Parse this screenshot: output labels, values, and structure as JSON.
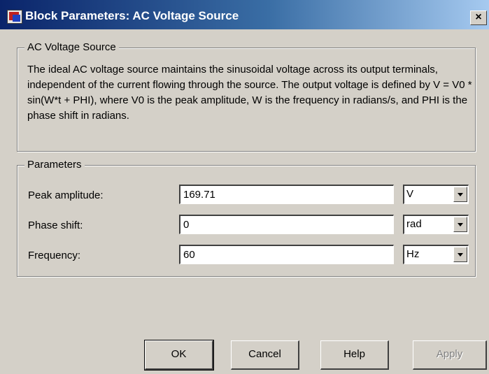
{
  "window": {
    "title": "Block Parameters: AC Voltage Source",
    "close_glyph": "×"
  },
  "description_group": {
    "legend": "AC Voltage Source",
    "text": "The ideal AC voltage source maintains the sinusoidal voltage across its output terminals, independent of the current flowing through the source. The output voltage is defined by  V = V0 * sin(W*t + PHI), where V0 is the peak amplitude, W is the frequency in radians/s, and PHI is the phase shift in radians."
  },
  "parameters": {
    "legend": "Parameters",
    "rows": [
      {
        "label": "Peak amplitude:",
        "value": "169.71",
        "unit": "V"
      },
      {
        "label": "Phase shift:",
        "value": "0",
        "unit": "rad"
      },
      {
        "label": "Frequency:",
        "value": "60",
        "unit": "Hz"
      }
    ]
  },
  "buttons": {
    "ok": "OK",
    "cancel": "Cancel",
    "help": "Help",
    "apply": "Apply"
  },
  "colors": {
    "title_start": "#0a246a",
    "title_end": "#a6caf0",
    "face": "#d4d0c8"
  }
}
